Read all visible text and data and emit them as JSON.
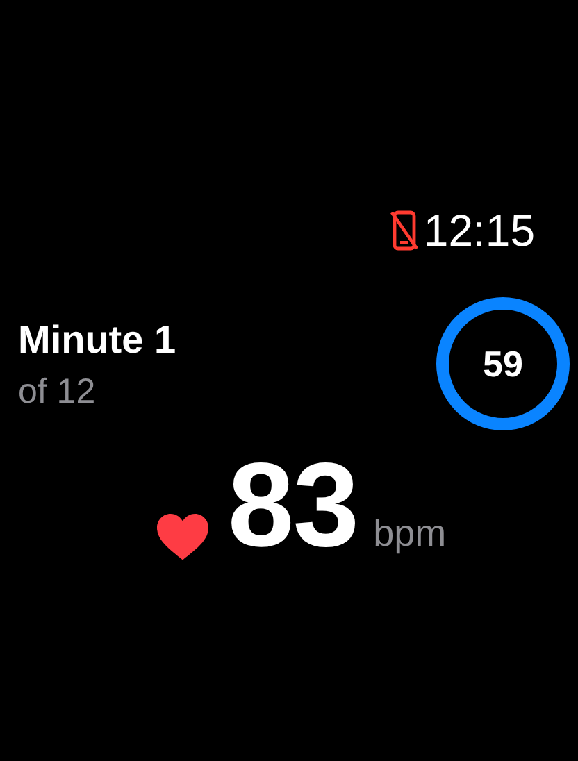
{
  "status_bar": {
    "phone_disconnected": true,
    "time": "12:15"
  },
  "interval": {
    "title": "Minute 1",
    "subtitle": "of 12"
  },
  "countdown": {
    "value": "59",
    "level": 1
  },
  "heart_rate": {
    "value": "83",
    "unit": "bpm"
  }
}
